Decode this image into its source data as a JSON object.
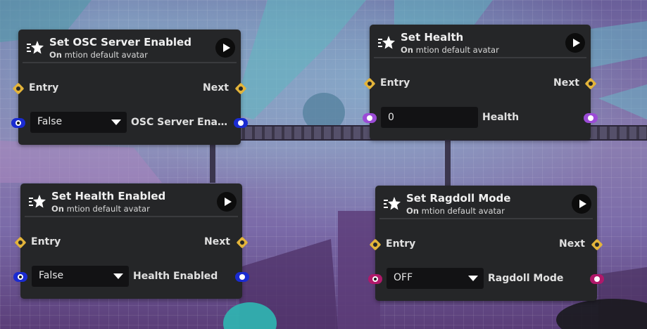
{
  "colors": {
    "exec_port": "#e3b43a",
    "bool_port": "#1a2bd0",
    "int_port": "#9b4bd6",
    "enum_port": "#b0186a",
    "node_bg": "#252628"
  },
  "nodes": {
    "osc": {
      "title": "Set OSC Server Enabled",
      "sub_prefix": "On",
      "sub_target": "mtion default avatar",
      "entry": "Entry",
      "next": "Next",
      "value": "False",
      "param": "OSC Server Ena…",
      "icon": "star-icon"
    },
    "health": {
      "title": "Set Health",
      "sub_prefix": "On",
      "sub_target": "mtion default avatar",
      "entry": "Entry",
      "next": "Next",
      "value": "0",
      "param": "Health",
      "icon": "star-icon"
    },
    "health_enabled": {
      "title": "Set Health Enabled",
      "sub_prefix": "On",
      "sub_target": "mtion default avatar",
      "entry": "Entry",
      "next": "Next",
      "value": "False",
      "param": "Health Enabled",
      "icon": "star-icon"
    },
    "ragdoll": {
      "title": "Set Ragdoll Mode",
      "sub_prefix": "On",
      "sub_target": "mtion default avatar",
      "entry": "Entry",
      "next": "Next",
      "value": "OFF",
      "param": "Ragdoll Mode",
      "icon": "star-icon"
    }
  }
}
